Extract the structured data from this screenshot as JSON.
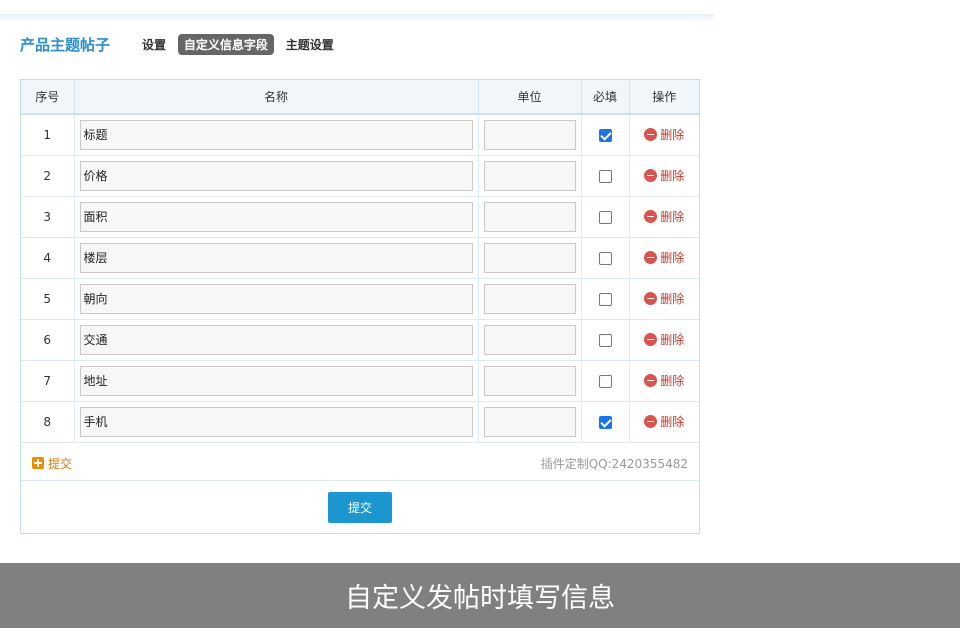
{
  "header": {
    "title": "产品主题帖子",
    "nav": [
      "设置",
      "自定义信息字段",
      "主题设置"
    ],
    "active_index": 1
  },
  "table": {
    "columns": [
      "序号",
      "名称",
      "单位",
      "必填",
      "操作"
    ],
    "rows": [
      {
        "no": "1",
        "name": "标题",
        "unit": "",
        "required": true
      },
      {
        "no": "2",
        "name": "价格",
        "unit": "",
        "required": false
      },
      {
        "no": "3",
        "name": "面积",
        "unit": "",
        "required": false
      },
      {
        "no": "4",
        "name": "楼层",
        "unit": "",
        "required": false
      },
      {
        "no": "5",
        "name": "朝向",
        "unit": "",
        "required": false
      },
      {
        "no": "6",
        "name": "交通",
        "unit": "",
        "required": false
      },
      {
        "no": "7",
        "name": "地址",
        "unit": "",
        "required": false
      },
      {
        "no": "8",
        "name": "手机",
        "unit": "",
        "required": true
      }
    ],
    "delete_label": "删除"
  },
  "footer": {
    "add_label": "提交",
    "credit": "插件定制QQ:2420355482",
    "submit_label": "提交"
  },
  "banner": {
    "text": "自定义发帖时填写信息"
  },
  "colors": {
    "accent": "#2a8ed0",
    "submit": "#1c96cf",
    "delete": "#c0392b",
    "add": "#e07b00",
    "banner_bg": "#808080"
  },
  "icons": {
    "delete": "minus-circle-icon",
    "add": "plus-square-icon"
  }
}
